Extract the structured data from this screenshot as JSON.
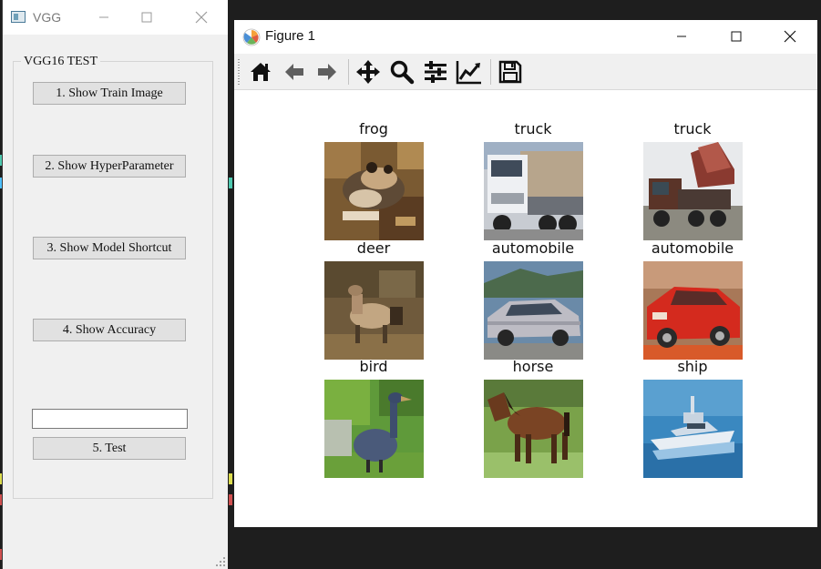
{
  "vgg_window": {
    "title": "VGG",
    "group_title": "VGG16 TEST",
    "buttons": {
      "show_train_image": "1. Show Train Image",
      "show_hyperparameter": "2. Show HyperParameter",
      "show_model_shortcut": "3. Show Model Shortcut",
      "show_accuracy": "4. Show Accuracy",
      "test": "5. Test"
    },
    "test_index_value": ""
  },
  "figure_window": {
    "title": "Figure 1",
    "toolbar_icons": [
      "home-icon",
      "back-arrow-icon",
      "forward-arrow-icon",
      "pan-icon",
      "zoom-icon",
      "subplots-config-icon",
      "axes-edit-icon",
      "save-icon"
    ],
    "image_labels": [
      "frog",
      "truck",
      "truck",
      "deer",
      "automobile",
      "automobile",
      "bird",
      "horse",
      "ship"
    ]
  },
  "colors": {
    "window_bg": "#f0f0f0",
    "button_bg": "#e1e1e1",
    "button_border": "#adadad",
    "desktop_bg": "#1e1e1e"
  }
}
